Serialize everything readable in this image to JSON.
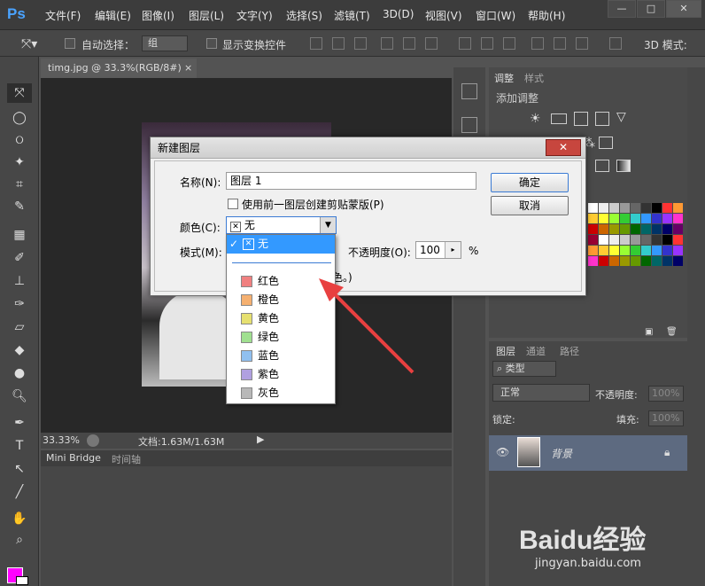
{
  "app_logo": "Ps",
  "menu": [
    "文件(F)",
    "编辑(E)",
    "图像(I)",
    "图层(L)",
    "文字(Y)",
    "选择(S)",
    "滤镜(T)",
    "3D(D)",
    "视图(V)",
    "窗口(W)",
    "帮助(H)"
  ],
  "window_controls": {
    "minimize": "—",
    "maximize": "□",
    "close": "✕"
  },
  "options_bar": {
    "auto_select_label": "自动选择：",
    "auto_select_value": "组",
    "show_transform_label": "显示变换控件",
    "mode_3d_label": "3D 模式:"
  },
  "document": {
    "tab_title": "timg.jpg @ 33.3%(RGB/8#)",
    "tab_close": "×",
    "zoom": "33.33%",
    "doc_size": "文档:1.63M/1.63M"
  },
  "bottom_tabs": [
    "Mini Bridge",
    "时间轴"
  ],
  "adjust_panel": {
    "tabs": [
      "调整",
      "样式"
    ],
    "heading": "添加调整"
  },
  "layers_panel": {
    "tabs": [
      "图层",
      "通道",
      "路径"
    ],
    "kind_label": "类型",
    "blend_mode": "正常",
    "opacity_label": "不透明度:",
    "opacity_value": "100%",
    "lock_label": "锁定:",
    "fill_label": "填充:",
    "fill_value": "100%",
    "layer_name": "背景"
  },
  "dialog": {
    "title": "新建图层",
    "close": "✕",
    "name_label": "名称(N):",
    "name_value": "图层 1",
    "clip_label": "使用前一图层创建剪贴蒙版(P)",
    "color_label": "颜色(C):",
    "color_value": "无",
    "mode_label": "模式(M):",
    "opacity_label": "不透明度(O):",
    "opacity_value": "100",
    "percent": "%",
    "partial_text": "色。)",
    "ok": "确定",
    "cancel": "取消"
  },
  "color_dropdown": {
    "selected": "无",
    "items": [
      {
        "label": "红色",
        "color": "#f08080"
      },
      {
        "label": "橙色",
        "color": "#f5b070"
      },
      {
        "label": "黄色",
        "color": "#e6e070"
      },
      {
        "label": "绿色",
        "color": "#a0e090"
      },
      {
        "label": "蓝色",
        "color": "#90c0f0"
      },
      {
        "label": "紫色",
        "color": "#b0a0e0"
      },
      {
        "label": "灰色",
        "color": "#b8b8b8"
      }
    ]
  },
  "watermark": {
    "brand": "Baidu经验",
    "url": "jingyan.baidu.com"
  },
  "colors": {
    "foreground": "#ff00ff",
    "background": "#ffffff",
    "accent": "#e84040"
  }
}
